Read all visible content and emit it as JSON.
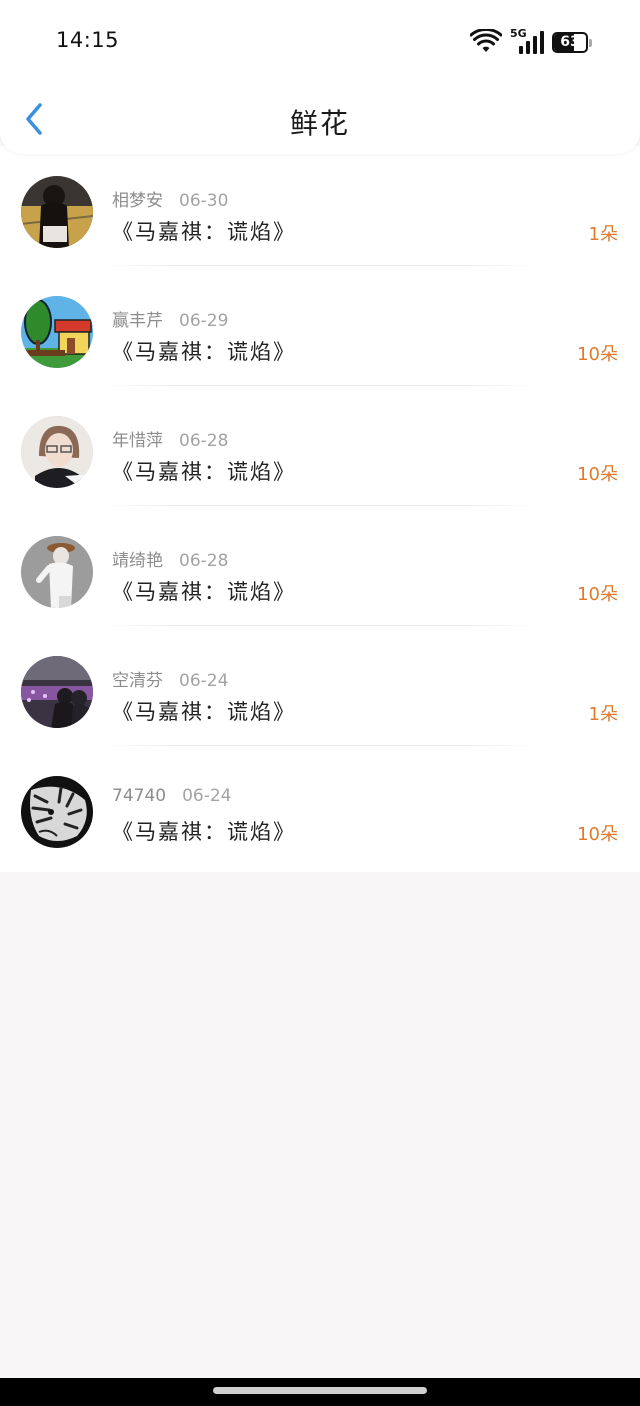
{
  "status_bar": {
    "time": "14:15",
    "network": "5G",
    "battery": "63",
    "battery_level": 0.63,
    "icons": [
      "wifi-icon",
      "cellular-signal-icon",
      "battery-icon"
    ]
  },
  "nav": {
    "title": "鲜花",
    "back_icon": "chevron-left-icon",
    "accent_color": "#3b8fe0"
  },
  "colors": {
    "count_color": "#e07a2e",
    "name_color": "#8d8d8d"
  },
  "records": [
    {
      "name": "相梦安",
      "date": "06-30",
      "book": "《马嘉祺：谎焰》",
      "count": "1朵"
    },
    {
      "name": "赢丰芹",
      "date": "06-29",
      "book": "《马嘉祺：谎焰》",
      "count": "10朵"
    },
    {
      "name": "年惜萍",
      "date": "06-28",
      "book": "《马嘉祺：谎焰》",
      "count": "10朵"
    },
    {
      "name": "靖绮艳",
      "date": "06-28",
      "book": "《马嘉祺：谎焰》",
      "count": "10朵"
    },
    {
      "name": "空清芬",
      "date": "06-24",
      "book": "《马嘉祺：谎焰》",
      "count": "1朵"
    },
    {
      "name": "74740",
      "date": "06-24",
      "book": "《马嘉祺：谎焰》",
      "count": "10朵"
    }
  ]
}
